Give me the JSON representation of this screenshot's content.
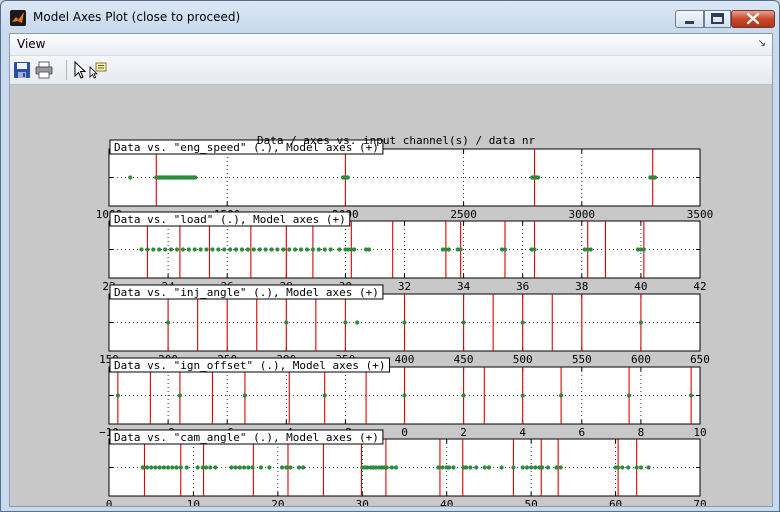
{
  "window": {
    "title": "Model Axes Plot (close to proceed)",
    "controls": [
      "minimize",
      "maximize",
      "close"
    ]
  },
  "menubar": {
    "view_label": "View"
  },
  "toolbar": {
    "icons": [
      "save-icon",
      "print-icon",
      "pointer-icon",
      "data-cursor-icon"
    ]
  },
  "figure": {
    "suptitle": "Data / axes vs. input channel(s) / data nr",
    "colors": {
      "data": "#2e8b3e",
      "model_axes": "#e00000",
      "background": "#c8c8c8"
    }
  },
  "chart_data": [
    {
      "type": "scatter",
      "title": "Data vs. \"eng_speed\" (.), Model axes (+)",
      "xlim": [
        1000,
        3500
      ],
      "ticks": [
        "1000",
        "1500",
        "2000",
        "2500",
        "3000",
        "3500"
      ],
      "tick_values": [
        1000,
        1500,
        2000,
        2500,
        3000,
        3500
      ],
      "model_axes": [
        1200,
        2000,
        2800,
        3300
      ],
      "data_x": [
        1090,
        1200,
        1205,
        1210,
        1215,
        1220,
        1225,
        1230,
        1235,
        1240,
        1245,
        1250,
        1255,
        1260,
        1265,
        1270,
        1275,
        1280,
        1285,
        1290,
        1295,
        1300,
        1305,
        1310,
        1315,
        1320,
        1325,
        1330,
        1335,
        1340,
        1345,
        1350,
        1355,
        1360,
        1365,
        1990,
        1995,
        2000,
        2005,
        2010,
        2790,
        2795,
        2800,
        2805,
        2810,
        2815,
        3290,
        3295,
        3300,
        3305,
        3310
      ]
    },
    {
      "type": "scatter",
      "title": "Data vs. \"load\" (.), Model axes (+)",
      "xlim": [
        22,
        42
      ],
      "ticks": [
        "22",
        "24",
        "26",
        "28",
        "30",
        "32",
        "34",
        "36",
        "38",
        "40",
        "42"
      ],
      "tick_values": [
        22,
        24,
        26,
        28,
        30,
        32,
        34,
        36,
        38,
        40,
        42
      ],
      "model_axes": [
        23.3,
        24.4,
        25.4,
        26.8,
        28.0,
        28.9,
        30.2,
        31.6,
        33.4,
        33.9,
        35.4,
        36.4,
        38.2,
        38.8,
        40.1
      ],
      "data_x": [
        23.1,
        23.3,
        23.5,
        23.7,
        23.9,
        24.1,
        24.3,
        24.5,
        24.7,
        24.9,
        25.1,
        25.3,
        25.5,
        25.7,
        25.9,
        26.1,
        26.3,
        26.5,
        26.7,
        26.9,
        27.1,
        27.3,
        27.5,
        27.7,
        27.9,
        28.1,
        28.3,
        28.5,
        28.7,
        28.9,
        29.1,
        29.3,
        29.5,
        29.8,
        30.0,
        30.1,
        30.2,
        30.3,
        30.7,
        30.8,
        33.3,
        33.4,
        33.5,
        33.8,
        33.9,
        35.3,
        35.4,
        36.3,
        36.4,
        38.1,
        38.2,
        38.3,
        39.9,
        40.0,
        40.1
      ]
    },
    {
      "type": "scatter",
      "title": "Data vs. \"inj_angle\" (.), Model axes (+)",
      "xlim": [
        150,
        650
      ],
      "ticks": [
        "150",
        "200",
        "250",
        "300",
        "350",
        "400",
        "450",
        "500",
        "550",
        "600",
        "650"
      ],
      "tick_values": [
        150,
        200,
        250,
        300,
        350,
        400,
        450,
        500,
        550,
        600,
        650
      ],
      "model_axes": [
        200,
        225,
        250,
        275,
        300,
        325,
        350,
        400,
        450,
        475,
        500,
        525,
        550,
        600
      ],
      "data_x": [
        200,
        300,
        350,
        360,
        400,
        450,
        500,
        600
      ]
    },
    {
      "type": "scatter",
      "title": "Data vs. \"ign_offset\" (.), Model axes (+)",
      "xlim": [
        -10,
        10
      ],
      "ticks": [
        "−10",
        "−8",
        "−6",
        "−4",
        "−2",
        "0",
        "2",
        "4",
        "6",
        "8",
        "10"
      ],
      "tick_values": [
        -10,
        -8,
        -6,
        -4,
        -2,
        0,
        2,
        4,
        6,
        8,
        10
      ],
      "model_axes": [
        -9.7,
        -8.6,
        -7.6,
        -6.5,
        -5.4,
        -3.9,
        -2.7,
        -1.3,
        0,
        2.0,
        2.7,
        4.0,
        5.3,
        7.6,
        9.7
      ],
      "data_x": [
        -9.7,
        -7.6,
        -5.4,
        -2.7,
        0,
        2.0,
        4.0,
        5.3,
        7.6,
        9.7
      ]
    },
    {
      "type": "scatter",
      "title": "Data vs. \"cam_angle\" (.), Model axes (+)",
      "xlim": [
        0,
        70
      ],
      "ticks": [
        "0",
        "10",
        "20",
        "30",
        "40",
        "50",
        "60",
        "70"
      ],
      "tick_values": [
        0,
        10,
        20,
        30,
        40,
        50,
        60,
        70
      ],
      "model_axes": [
        4.2,
        8.5,
        11.2,
        17.1,
        21.2,
        25.4,
        29.9,
        32.8,
        39.2,
        41.9,
        47.9,
        51.2,
        53.2,
        60.3,
        62.5
      ],
      "data_x": [
        4.0,
        4.5,
        5.0,
        5.5,
        6.0,
        6.5,
        7.0,
        7.5,
        8.0,
        8.5,
        9.2,
        10.5,
        11.1,
        11.5,
        12.0,
        12.6,
        14.5,
        15.0,
        15.5,
        16.0,
        16.5,
        17.0,
        18.0,
        19.0,
        20.5,
        21.0,
        21.5,
        22.5,
        23.0,
        30.0,
        30.3,
        30.6,
        31.0,
        31.3,
        31.6,
        32.0,
        32.3,
        32.6,
        32.9,
        33.5,
        34.0,
        39.0,
        39.5,
        40.0,
        40.3,
        40.8,
        42.0,
        42.3,
        42.8,
        43.5,
        44.5,
        45.0,
        46.5,
        47.9,
        49.0,
        49.5,
        50.0,
        50.5,
        51.0,
        51.3,
        52.0,
        53.0,
        53.5,
        60.0,
        60.3,
        60.8,
        61.5,
        62.5,
        63.0,
        63.9
      ]
    }
  ]
}
